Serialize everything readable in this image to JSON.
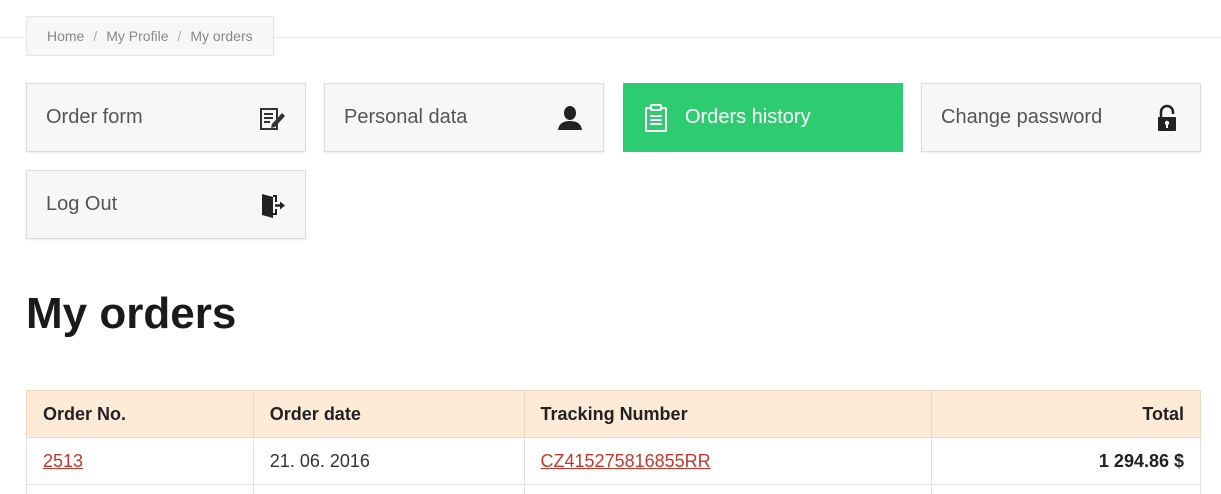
{
  "breadcrumb": {
    "home": "Home",
    "profile": "My Profile",
    "current": "My orders",
    "separator": "/"
  },
  "tiles": {
    "order_form": {
      "label": "Order form",
      "icon": "document-edit-icon"
    },
    "personal_data": {
      "label": "Personal data",
      "icon": "user-icon"
    },
    "orders_history": {
      "label": "Orders history",
      "icon": "clipboard-icon"
    },
    "change_password": {
      "label": "Change password",
      "icon": "lock-icon"
    },
    "log_out": {
      "label": "Log Out",
      "icon": "logout-door-icon"
    }
  },
  "page_title": "My orders",
  "table": {
    "headers": {
      "order_no": "Order No.",
      "order_date": "Order date",
      "tracking": "Tracking Number",
      "total": "Total"
    },
    "rows": [
      {
        "order_no": "2513",
        "order_date": "21. 06. 2016",
        "tracking": "CZ415275816855RR",
        "total": "1 294.86 $"
      }
    ]
  },
  "colors": {
    "active_tile": "#2ecc71",
    "header_bg": "#fdebd8",
    "link": "#c0392b"
  }
}
